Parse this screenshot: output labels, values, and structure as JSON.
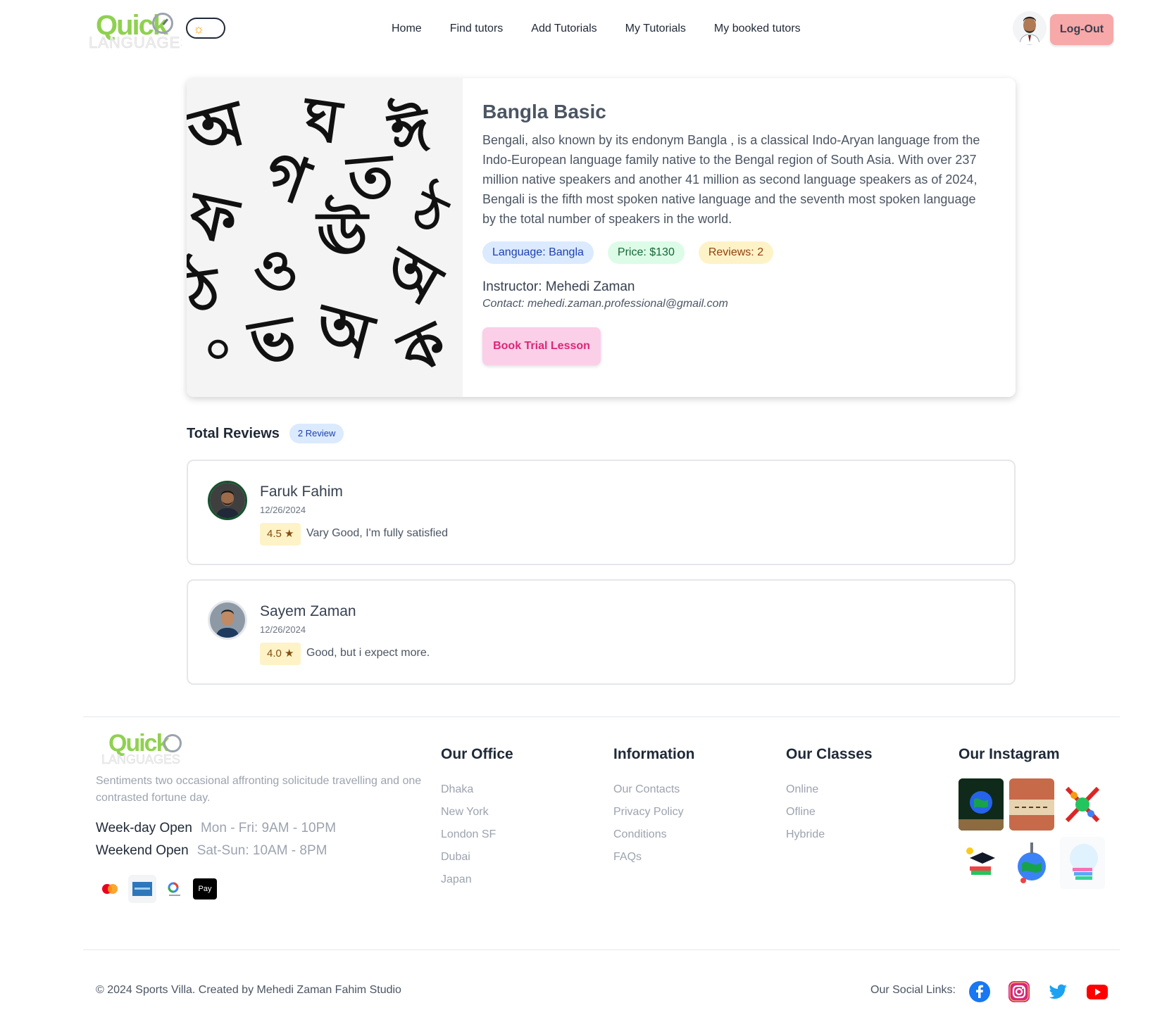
{
  "nav": {
    "logo_text": "Quick",
    "logo_sub": "LANGUAGES",
    "menu": [
      "Home",
      "Find tutors",
      "Add Tutorials",
      "My Tutorials",
      "My booked tutors"
    ],
    "logout": "Log-Out",
    "theme_icon": "sun-icon"
  },
  "course": {
    "title": "Bangla Basic",
    "description": "Bengali, also known by its endonym Bangla , is a classical Indo-Aryan language from the Indo-European language family native to the Bengal region of South Asia. With over 237 million native speakers and another 41 million as second language speakers as of 2024, Bengali is the fifth most spoken native language and the seventh most spoken language by the total number of speakers in the world.",
    "language_badge": "Language: Bangla",
    "price_badge": "Price: $130",
    "reviews_badge": "Reviews: 2",
    "instructor": "Instructor: Mehedi Zaman",
    "contact": "Contact: mehedi.zaman.professional@gmail.com",
    "book_button": "Book Trial Lesson",
    "image_glyphs": [
      "অ",
      "ঘ",
      "ঈ",
      "গ",
      "ত",
      "ফ",
      "ঊ",
      "ঠ",
      "ঠ",
      "ও",
      "অ",
      "ভ",
      "অ",
      "ক",
      "০"
    ]
  },
  "reviews": {
    "title": "Total Reviews",
    "count_label": "2 Review",
    "items": [
      {
        "name": "Faruk Fahim",
        "date": "12/26/2024",
        "rating": "4.5 ★",
        "text": "Vary Good, I'm fully satisfied"
      },
      {
        "name": "Sayem Zaman",
        "date": "12/26/2024",
        "rating": "4.0 ★",
        "text": "Good, but i expect more."
      }
    ]
  },
  "footer": {
    "logo_text": "Quick",
    "logo_sub": "LANGUAGES",
    "description": "Sentiments two occasional affronting solicitude travelling and one contrasted fortune day.",
    "weekday_label": "Week-day Open",
    "weekday_hours": "Mon - Fri: 9AM - 10PM",
    "weekend_label": "Weekend Open",
    "weekend_hours": "Sat-Sun: 10AM - 8PM",
    "payments": [
      "mastercard-icon",
      "amex-icon",
      "google-pay-icon",
      "apple-pay-icon"
    ],
    "office": {
      "title": "Our Office",
      "items": [
        "Dhaka",
        "New York",
        "London SF",
        "Dubai",
        "Japan"
      ]
    },
    "information": {
      "title": "Information",
      "items": [
        "Our Contacts",
        "Privacy Policy",
        "Conditions",
        "FAQs"
      ]
    },
    "classes": {
      "title": "Our Classes",
      "items": [
        "Online",
        "Ofline",
        "Hybride"
      ]
    },
    "instagram": {
      "title": "Our Instagram"
    },
    "copyright": "© 2024 Sports Villa. Created by Mehedi Zaman Fahim Studio",
    "social_label": "Our Social Links:",
    "apple_pay_text": "Pay",
    "colors": {
      "facebook": "#1877f2",
      "instagram": "#d62976",
      "twitter": "#1da1f2",
      "youtube": "#ff0000"
    }
  }
}
